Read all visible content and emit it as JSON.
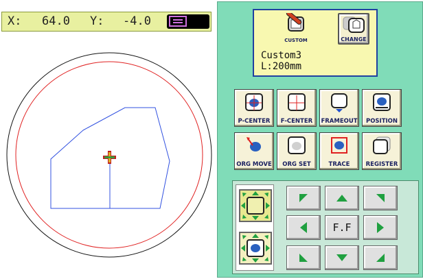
{
  "coords": {
    "x_label": "X:",
    "x_value": "64.0",
    "y_label": "Y:",
    "y_value": "-4.0"
  },
  "hoop_card": {
    "custom_label": "CUSTOM",
    "change_label": "CHANGE",
    "hoop_name_line1": "Custom3",
    "hoop_name_line2": "L:200mm"
  },
  "tools": [
    {
      "label": "P-CENTER"
    },
    {
      "label": "F-CENTER"
    },
    {
      "label": "FRAMEOUT"
    },
    {
      "label": "POSITION"
    },
    {
      "label": "ORG MOVE"
    },
    {
      "label": "ORG SET"
    },
    {
      "label": "TRACE"
    },
    {
      "label": "REGISTER"
    }
  ],
  "dpad": {
    "center_label": "F.F"
  },
  "colors": {
    "accent_green": "#3a9a5a",
    "panel_green": "#80dcb8",
    "hoop_red": "#e02020",
    "pattern_blue": "#3050e0"
  }
}
